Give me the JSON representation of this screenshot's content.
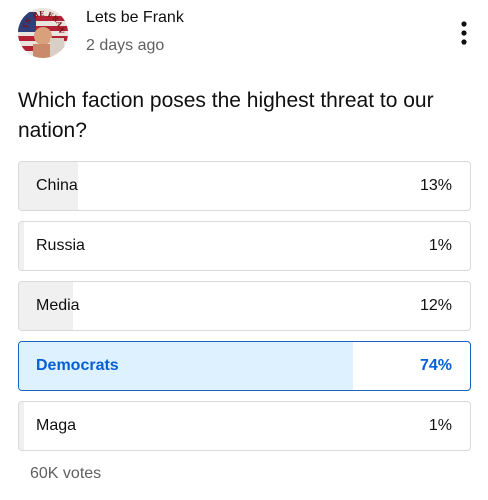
{
  "post": {
    "channel_name": "Lets be Frank",
    "time_ago": "2 days ago",
    "avatar_text": "LETS BE FRANK",
    "menu_icon": "more-vert-icon"
  },
  "poll": {
    "question": "Which faction poses the highest threat to our nation?",
    "options": [
      {
        "label": "China",
        "percent_text": "13%",
        "percent": 13,
        "selected": false
      },
      {
        "label": "Russia",
        "percent_text": "1%",
        "percent": 1,
        "selected": false
      },
      {
        "label": "Media",
        "percent_text": "12%",
        "percent": 12,
        "selected": false
      },
      {
        "label": "Democrats",
        "percent_text": "74%",
        "percent": 74,
        "selected": true
      },
      {
        "label": "Maga",
        "percent_text": "1%",
        "percent": 1,
        "selected": false
      }
    ],
    "vote_count": "60K votes"
  },
  "colors": {
    "selected_border": "#1565c0",
    "selected_fill": "#def1ff",
    "selected_text": "#065fd4",
    "bar_fill": "#f0f0f0"
  }
}
